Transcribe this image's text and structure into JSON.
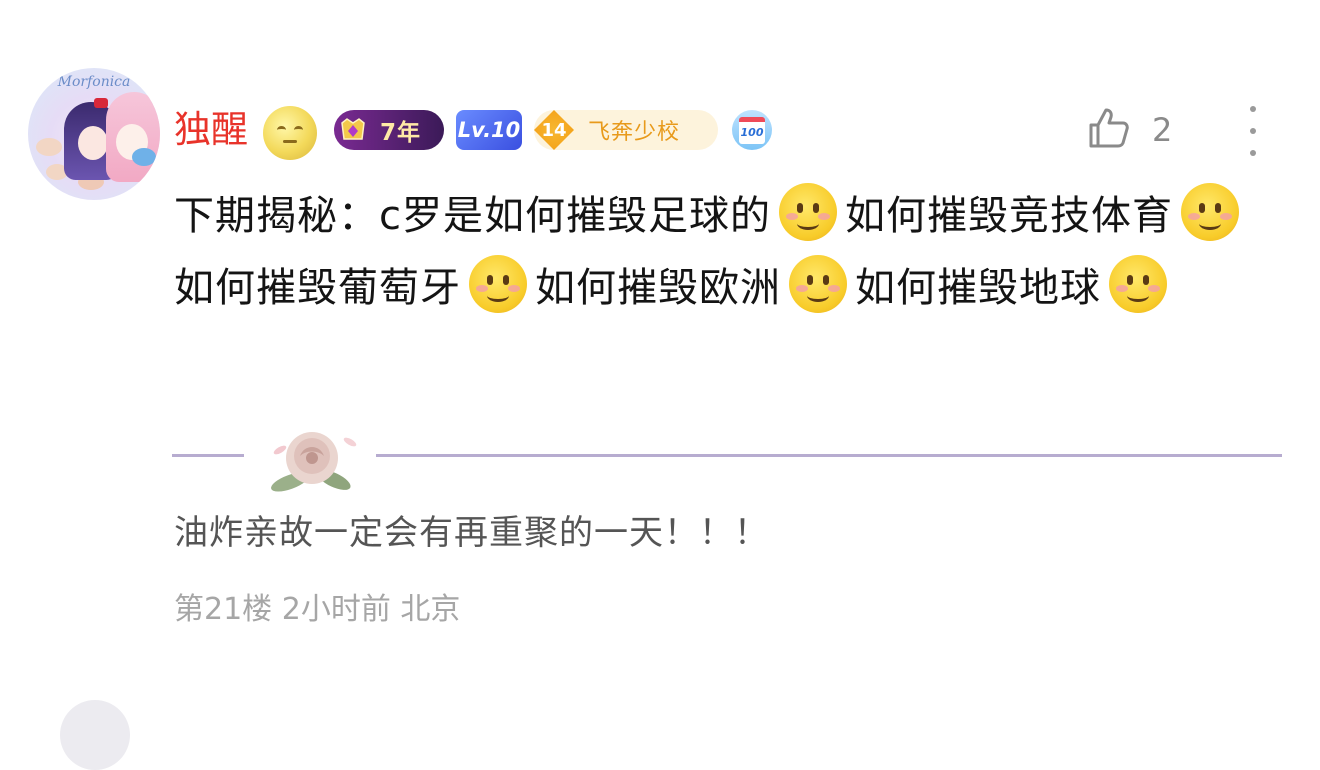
{
  "comment": {
    "username": "独醒",
    "badges": {
      "years": "7年",
      "level": "Lv.10",
      "school_level": "14",
      "school_name": "飞奔少校",
      "calendar": "100"
    },
    "avatar_logo": "Morfonica",
    "likes": "2",
    "content_segments": [
      "下期揭秘：c罗是如何摧毁足球的",
      "如何摧毁竞技体育",
      "如何摧毁葡萄牙",
      "如何摧毁欧洲",
      "如何摧毁地球"
    ],
    "signature": "油炸亲故一定会有再重聚的一天！！！",
    "floor": "第21楼",
    "time": "2小时前",
    "location": "北京"
  },
  "colors": {
    "username": "#e8332a",
    "divider": "#b7acd0",
    "meta": "#a6a6a6",
    "school_badge_text": "#e89a1b"
  },
  "icons": {
    "like": "thumbs-up-icon",
    "more": "more-vertical-icon",
    "emoji": "smile-emoji-icon"
  }
}
